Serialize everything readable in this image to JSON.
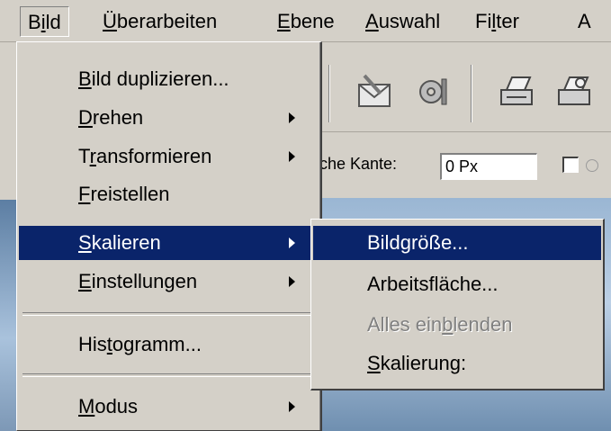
{
  "menubar": {
    "items": [
      {
        "pre": "B",
        "u": "i",
        "post": "ld"
      },
      {
        "pre": "",
        "u": "Ü",
        "post": "berarbeiten"
      },
      {
        "pre": "",
        "u": "E",
        "post": "bene"
      },
      {
        "pre": "",
        "u": "A",
        "post": "uswahl"
      },
      {
        "pre": "Fi",
        "u": "l",
        "post": "ter"
      },
      {
        "pre": "A",
        "u": "",
        "post": ""
      }
    ]
  },
  "toolbar": {
    "icons": [
      "email-icon",
      "tools-icon",
      "print-icon",
      "print-preview-icon"
    ]
  },
  "options": {
    "edge_label": "che Kante:",
    "edge_value": "0 Px"
  },
  "mainmenu": {
    "items": [
      {
        "pre": "",
        "u": "B",
        "post": "ild duplizieren..."
      },
      {
        "pre": "",
        "u": "D",
        "post": "rehen"
      },
      {
        "pre": "T",
        "u": "r",
        "post": "ansformieren"
      },
      {
        "pre": "",
        "u": "F",
        "post": "reistellen"
      },
      {
        "pre": "",
        "u": "S",
        "post": "kalieren"
      },
      {
        "pre": "",
        "u": "E",
        "post": "instellungen"
      },
      {
        "pre": "His",
        "u": "t",
        "post": "ogramm..."
      },
      {
        "pre": "",
        "u": "M",
        "post": "odus"
      }
    ]
  },
  "submenu": {
    "items": [
      {
        "pre": "Bild",
        "u": "g",
        "post": "röße..."
      },
      {
        "pre": "Arbeitsfläche...",
        "u": "",
        "post": ""
      },
      {
        "pre": "Alles ein",
        "u": "b",
        "post": "lenden"
      },
      {
        "pre": "",
        "u": "S",
        "post": "kalierung:"
      }
    ]
  }
}
